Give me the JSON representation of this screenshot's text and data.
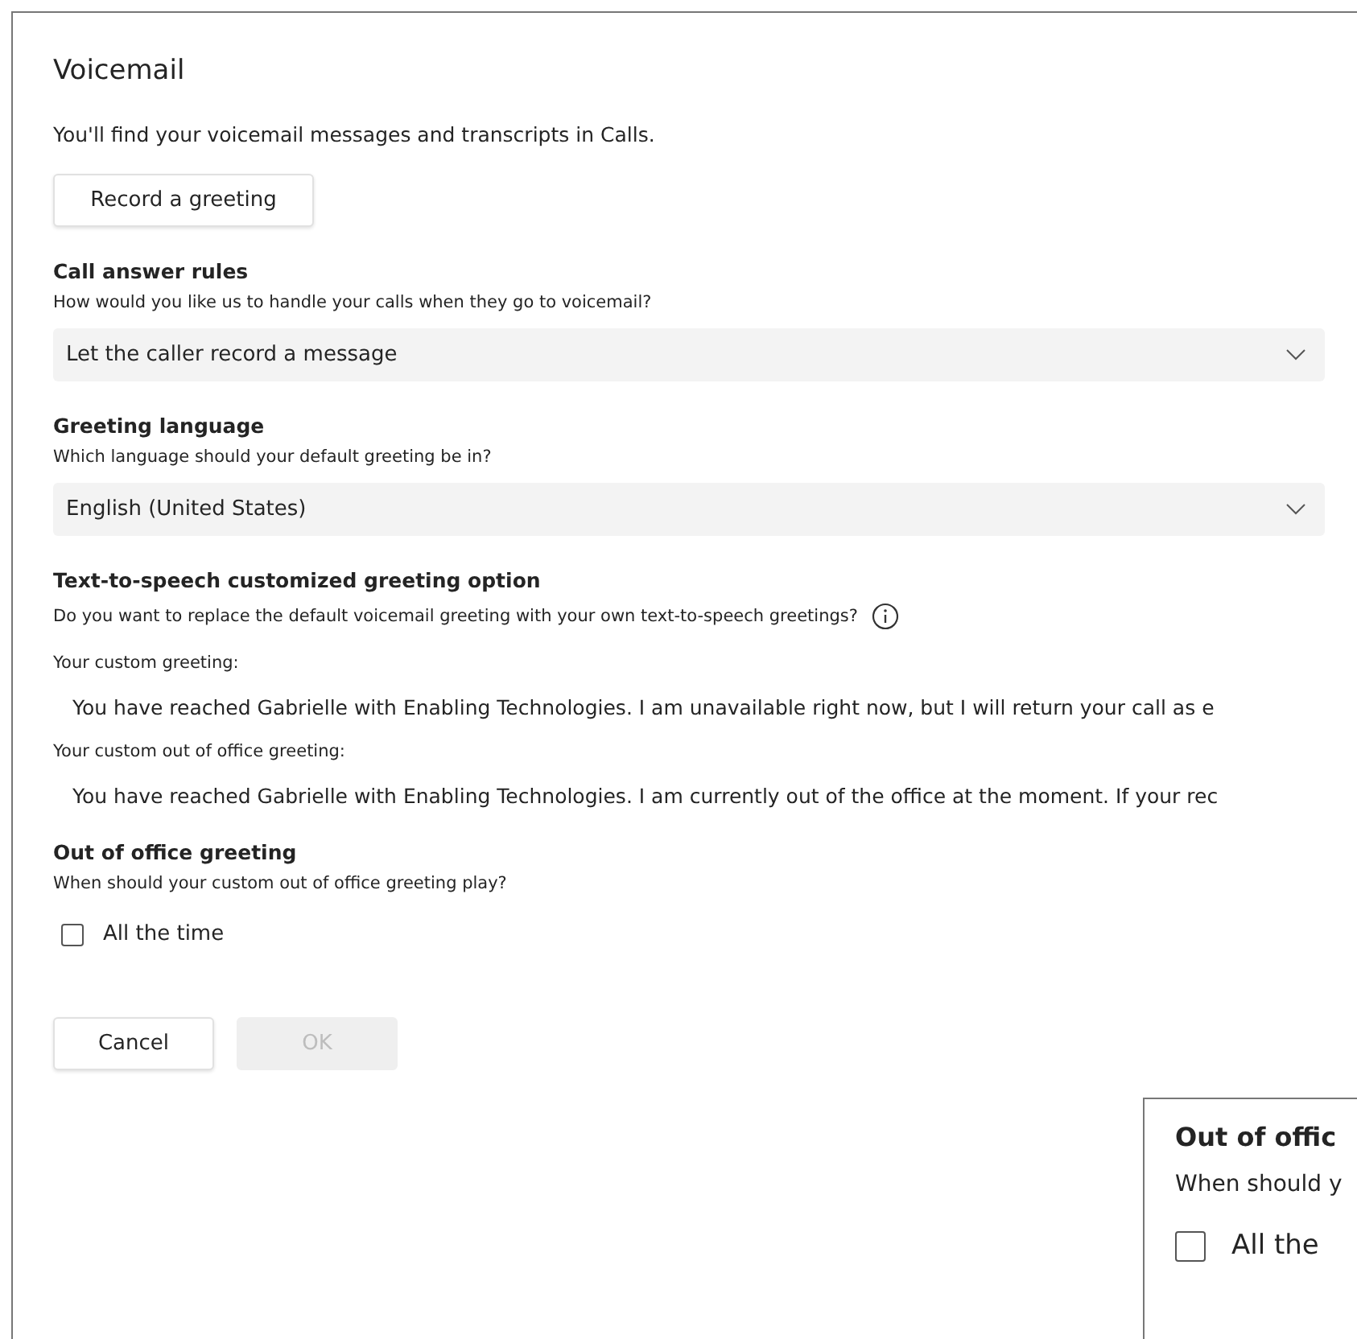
{
  "title": "Voicemail",
  "intro": "You'll find your voicemail messages and transcripts in Calls.",
  "record_button": "Record a greeting",
  "sections": [
    {
      "kind": "dropdown",
      "heading": "Call answer rules",
      "description": "How would you like us to handle your calls when they go to voicemail?",
      "value": "Let the caller record a message"
    },
    {
      "kind": "dropdown",
      "heading": "Greeting language",
      "description": "Which language should your default greeting be in?",
      "value": "English (United States)"
    },
    {
      "kind": "tts",
      "heading": "Text-to-speech customized greeting option",
      "description": "Do you want to replace the default voicemail greeting with your own text-to-speech greetings?",
      "fields": [
        {
          "label": "Your custom greeting:",
          "value": "You have reached Gabrielle with Enabling Technologies. I am unavailable right now, but I will return your call as e"
        },
        {
          "label": "Your custom out of office greeting:",
          "value": "You have reached Gabrielle with Enabling Technologies. I am currently out of the office at the moment. If your rec"
        }
      ]
    },
    {
      "kind": "checkbox",
      "heading": "Out of office greeting",
      "description": "When should your custom out of office greeting play?",
      "option": {
        "label": "All the time",
        "checked": false
      }
    }
  ],
  "buttons": [
    {
      "label": "Cancel",
      "disabled": false
    },
    {
      "label": "OK",
      "disabled": true
    }
  ],
  "zoom_inset": {
    "heading": "Out of offic",
    "description": "When should y",
    "option": {
      "label": "All the",
      "checked": false
    }
  }
}
